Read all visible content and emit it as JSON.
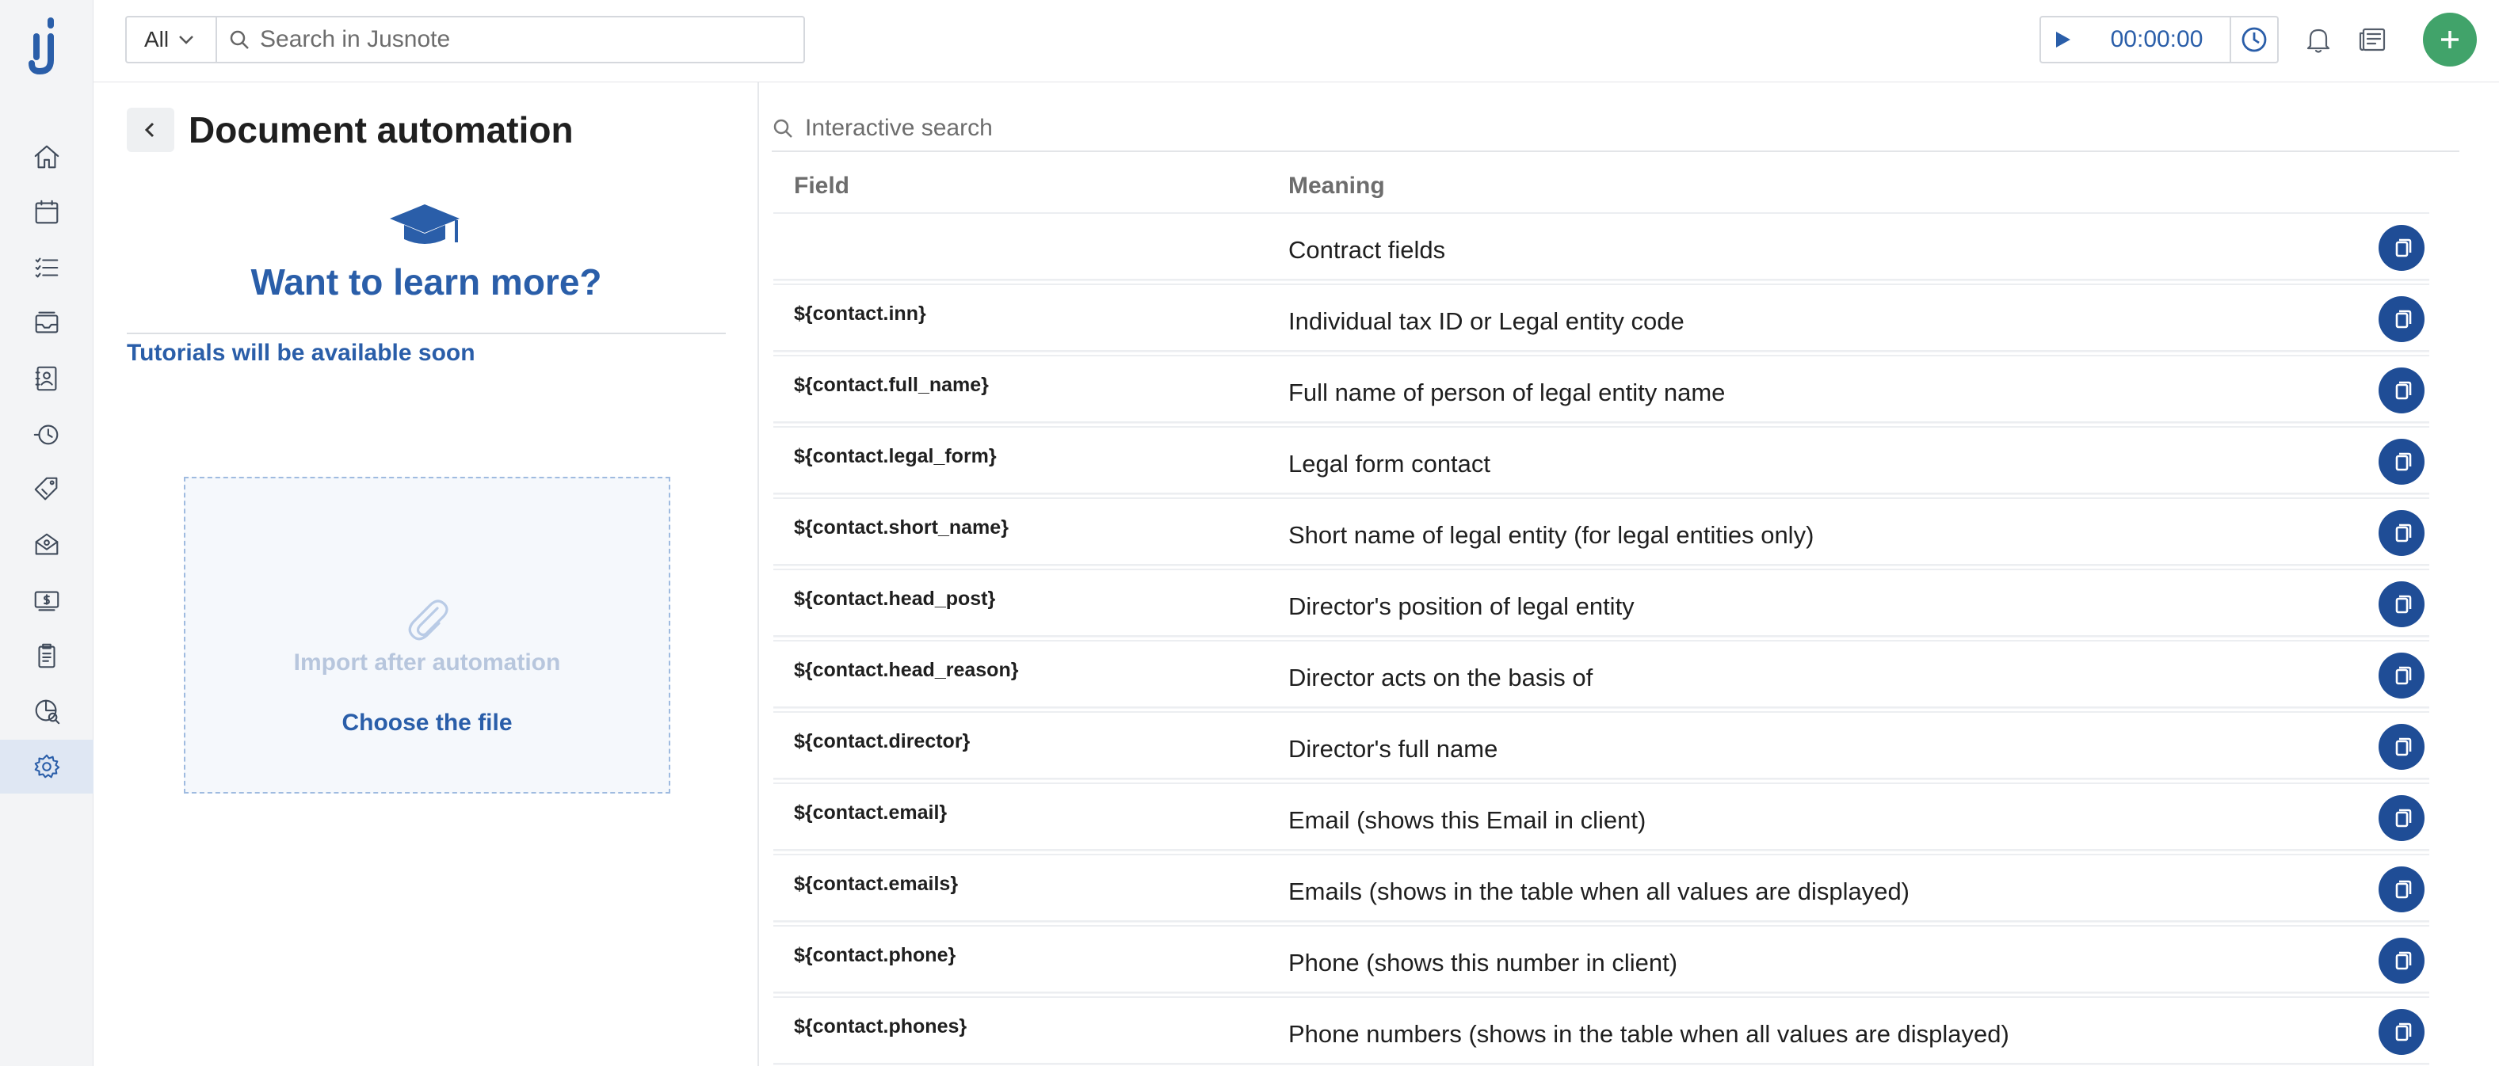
{
  "topbar": {
    "scope": "All",
    "search_placeholder": "Search in Jusnote",
    "timer": "00:00:00"
  },
  "sidebar": {
    "items": [
      {
        "icon": "home-icon"
      },
      {
        "icon": "calendar-icon"
      },
      {
        "icon": "tasks-icon"
      },
      {
        "icon": "inbox-icon"
      },
      {
        "icon": "contacts-icon"
      },
      {
        "icon": "history-icon"
      },
      {
        "icon": "tags-icon"
      },
      {
        "icon": "mail-icon"
      },
      {
        "icon": "billing-icon"
      },
      {
        "icon": "documents-icon"
      },
      {
        "icon": "reports-icon"
      },
      {
        "icon": "settings-icon",
        "active": true
      }
    ]
  },
  "left_panel": {
    "title": "Document automation",
    "learn_title": "Want to learn more?",
    "tutorials_note": "Tutorials will be available soon",
    "import_label": "Import after automation",
    "choose_file": "Choose the file"
  },
  "table": {
    "search_placeholder": "Interactive search",
    "columns": {
      "field": "Field",
      "meaning": "Meaning"
    },
    "rows": [
      {
        "field": "",
        "meaning": "Contract fields"
      },
      {
        "field": "${contact.inn}",
        "meaning": "Individual tax ID or Legal entity code"
      },
      {
        "field": "${contact.full_name}",
        "meaning": "Full name of person of legal entity name"
      },
      {
        "field": "${contact.legal_form}",
        "meaning": "Legal form contact"
      },
      {
        "field": "${contact.short_name}",
        "meaning": "Short name of legal entity (for legal entities only)"
      },
      {
        "field": "${contact.head_post}",
        "meaning": "Director's position of legal entity"
      },
      {
        "field": "${contact.head_reason}",
        "meaning": "Director acts on the basis of"
      },
      {
        "field": "${contact.director}",
        "meaning": "Director's full name"
      },
      {
        "field": "${contact.email}",
        "meaning": "Email (shows this Email in client)"
      },
      {
        "field": "${contact.emails}",
        "meaning": "Emails (shows in the table when all values are displayed)"
      },
      {
        "field": "${contact.phone}",
        "meaning": "Phone (shows this number in client)"
      },
      {
        "field": "${contact.phones}",
        "meaning": "Phone numbers (shows in the table when all values are displayed)"
      }
    ]
  },
  "colors": {
    "brand_blue": "#2a5ea9",
    "copy_button": "#1f4d96",
    "add_button": "#41a36a"
  }
}
